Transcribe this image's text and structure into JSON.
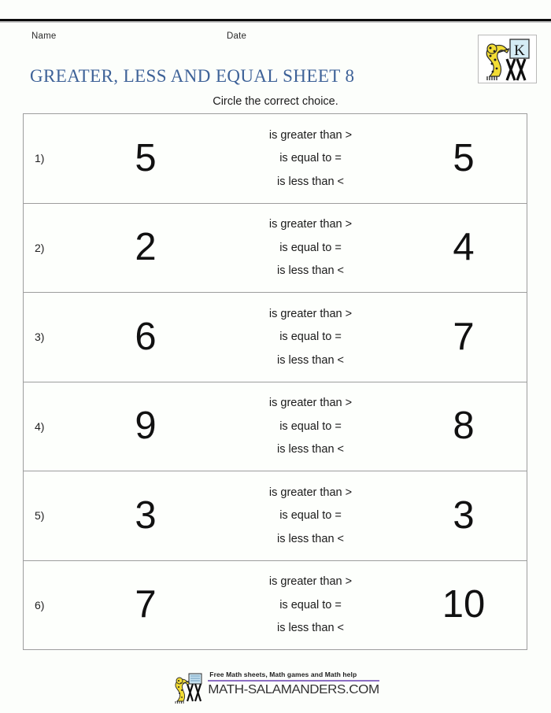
{
  "header": {
    "name_label": "Name",
    "date_label": "Date",
    "title": "GREATER, LESS AND EQUAL SHEET 8",
    "subtitle": "Circle the correct choice.",
    "title_color": "#3e6298",
    "logo_icon": "math-salamanders-logo-icon"
  },
  "worksheet": {
    "choices": {
      "greater": "is greater than >",
      "equal": "is equal to =",
      "less": "is less than <"
    },
    "rows": [
      {
        "index": "1)",
        "left": "5",
        "right": "5"
      },
      {
        "index": "2)",
        "left": "2",
        "right": "4"
      },
      {
        "index": "3)",
        "left": "6",
        "right": "7"
      },
      {
        "index": "4)",
        "left": "9",
        "right": "8"
      },
      {
        "index": "5)",
        "left": "3",
        "right": "3"
      },
      {
        "index": "6)",
        "left": "7",
        "right": "10"
      }
    ]
  },
  "footer": {
    "tagline": "Free Math sheets, Math games and Math help",
    "domain": "MATH-SALAMANDERS.COM",
    "accent_color": "#8d6fc4",
    "logo_icon": "math-salamanders-footer-logo-icon"
  }
}
